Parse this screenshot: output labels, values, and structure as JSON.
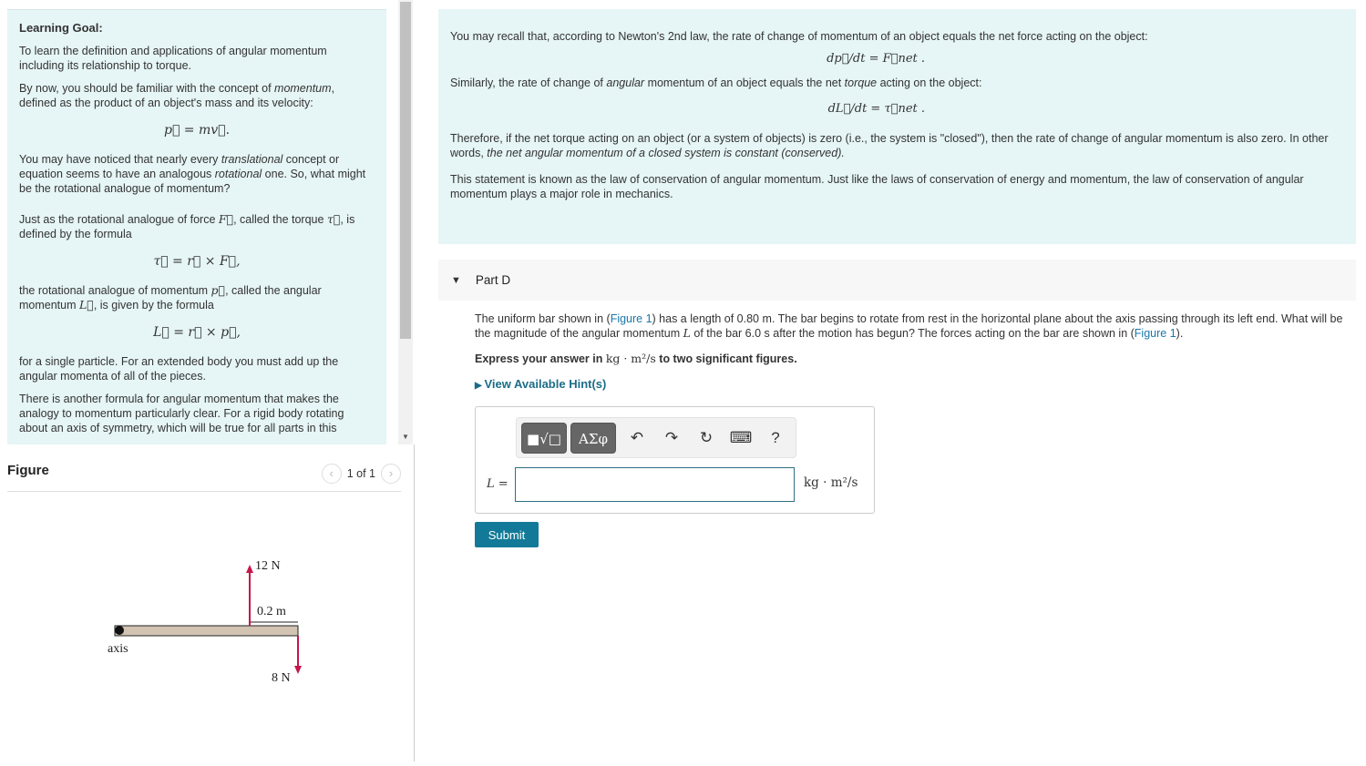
{
  "left": {
    "title": "Learning Goal:",
    "p1": "To learn the definition and applications of angular momentum including its relationship to torque.",
    "p2a": "By now, you should be familiar with the concept of ",
    "p2em": "momentum",
    "p2b": ", defined as the product of an object's mass and its velocity:",
    "eq1": "p⃗ = mv⃗.",
    "p3a": "You may have noticed that nearly every ",
    "p3em1": "translational",
    "p3b": " concept or equation seems to have an analogous ",
    "p3em2": "rotational",
    "p3c": " one. So, what might be the rotational analogue of momentum?",
    "p4a": "Just as the rotational analogue of force ",
    "p4m1": "F⃗",
    "p4b": ", called the torque ",
    "p4m2": "τ⃗",
    "p4c": ", is defined by the formula",
    "eq2": "τ⃗ = r⃗ × F⃗,",
    "p5a": "the rotational analogue of momentum ",
    "p5m1": "p⃗",
    "p5b": ", called the angular momentum ",
    "p5m2": "L⃗",
    "p5c": ", is given by the formula",
    "eq3": "L⃗ = r⃗ × p⃗,",
    "p6": "for a single particle. For an extended body you must add up the angular momenta of all of the pieces.",
    "p7": "There is another formula for angular momentum that makes the analogy to momentum particularly clear. For a rigid body rotating about an axis of symmetry, which will be true for all parts in this"
  },
  "figure": {
    "title": "Figure",
    "pager": "1 of 1",
    "force_up": "12 N",
    "force_down": "8 N",
    "distance": "0.2 m",
    "axis_label": "axis"
  },
  "right": {
    "p1": "You may recall that, according to Newton's 2nd law, the rate of change of momentum of an object equals the net force acting on the object:",
    "eq1": "dp⃗/dt = F⃗net .",
    "p2a": "Similarly, the rate of change of ",
    "p2em1": "angular",
    "p2b": " momentum of an object equals the net ",
    "p2em2": "torque",
    "p2c": " acting on the object:",
    "eq2": "dL⃗/dt = τ⃗net .",
    "p3a": "Therefore, if the net torque acting on an object (or a system of objects) is zero (i.e., the system is \"closed\"), then the rate of change of angular momentum is also zero. In other words, ",
    "p3em": "the net angular momentum of a closed system is constant (conserved).",
    "p4": "This statement is known as the law of conservation of angular momentum. Just like the laws of conservation of energy and momentum, the law of conservation of angular momentum plays a major role in mechanics."
  },
  "part": {
    "label": "Part D",
    "q1": "The uniform bar shown in (",
    "link": "Figure 1",
    "q2": ") has a length of 0.80 m. The bar begins to rotate from rest in the horizontal plane about the axis passing through its left end. What will be the magnitude of the angular momentum ",
    "qL": "L",
    "q3": " of the bar 6.0 s after the motion has begun? The forces acting on the bar are shown in (",
    "q4": ").",
    "express_a": "Express your answer in ",
    "express_unit": "kg · m²/s",
    "express_b": " to two significant figures.",
    "hint": "View Available Hint(s)",
    "toolbar": {
      "greek": "ΑΣφ",
      "help": "?"
    },
    "answer_label": "L =",
    "answer_value": "",
    "unit": "kg · m²/s",
    "submit": "Submit"
  }
}
